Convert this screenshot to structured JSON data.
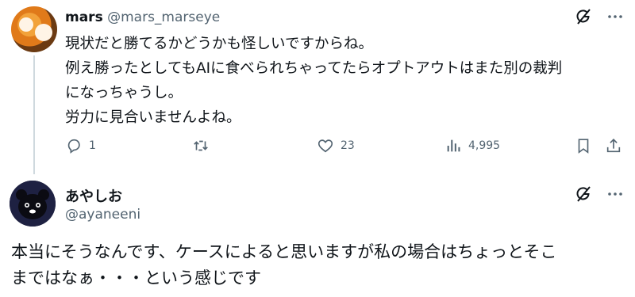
{
  "post1": {
    "author": {
      "name": "mars",
      "handle": "@mars_marseye"
    },
    "body": "現状だと勝てるかどうかも怪しいですからね。\n例え勝ったとしてもAIに食べられちゃってたらオプトアウトはまた別の裁判\nになっちゃうし。\n労力に見合いませんよね。",
    "actions": {
      "reply_count": "1",
      "repost_count": "",
      "like_count": "23",
      "views_count": "4,995"
    },
    "top_icons": [
      "grok-icon",
      "more-icon"
    ]
  },
  "post2": {
    "author": {
      "name": "あやしお",
      "handle": "@ayaneeni"
    },
    "body": "本当にそうなんです、ケースによると思いますが私の場合はちょっとそこ\nまではなぁ・・・という感じです",
    "top_icons": [
      "grok-icon",
      "more-icon"
    ]
  },
  "colors": {
    "text": "#0f1419",
    "secondary": "#536471",
    "thread_line": "#cfd9de"
  }
}
